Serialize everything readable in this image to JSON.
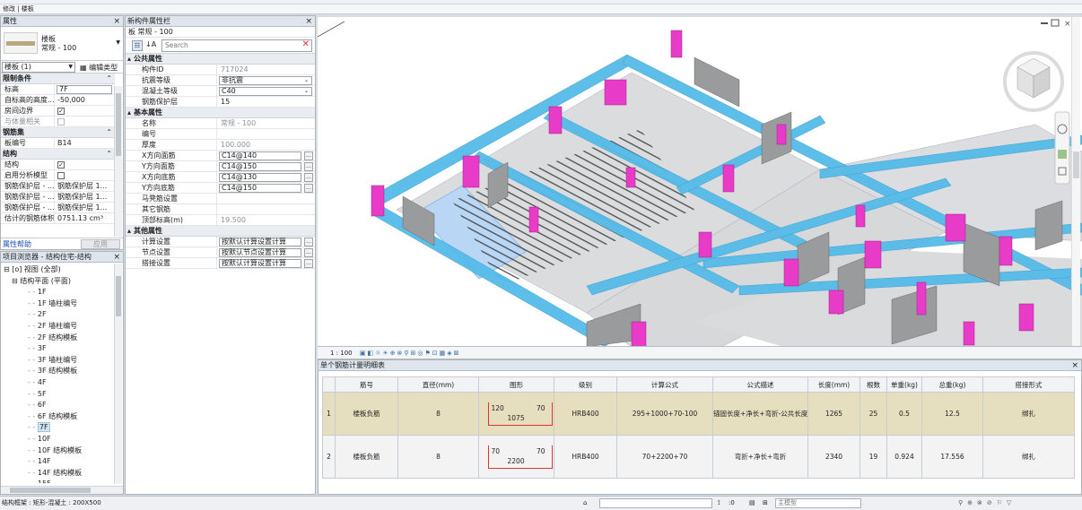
{
  "modebar": {
    "text": "修改 | 楼板"
  },
  "left_panel": {
    "title": "属性",
    "type_name": "楼板",
    "type_sub": "常规 - 100",
    "instance_selector": "楼板 (1)",
    "edit_type": "编辑类型",
    "groups": [
      {
        "name": "限制条件",
        "rows": [
          {
            "label": "标高",
            "value": "7F",
            "kind": "input"
          },
          {
            "label": "自标高的高度...",
            "value": "-50,000",
            "kind": "text"
          },
          {
            "label": "房间边界",
            "value": "✓",
            "kind": "check"
          },
          {
            "label": "与体量相关",
            "value": "",
            "kind": "check-gray"
          }
        ]
      },
      {
        "name": "钢筋集",
        "rows": [
          {
            "label": "板编号",
            "value": "B14",
            "kind": "text"
          }
        ]
      },
      {
        "name": "结构",
        "rows": [
          {
            "label": "结构",
            "value": "✓",
            "kind": "check"
          },
          {
            "label": "启用分析模型",
            "value": "",
            "kind": "check"
          },
          {
            "label": "钢筋保护层 - ...",
            "value": "钢筋保护层 1...",
            "kind": "text"
          },
          {
            "label": "钢筋保护层 - ...",
            "value": "钢筋保护层 1...",
            "kind": "text"
          },
          {
            "label": "钢筋保护层 - ...",
            "value": "钢筋保护层 1...",
            "kind": "text"
          },
          {
            "label": "估计的钢筋体积",
            "value": "0751.13 cm³",
            "kind": "text"
          }
        ]
      }
    ],
    "help_link": "属性帮助",
    "apply": "应用"
  },
  "browser": {
    "title": "项目浏览器 - 结构住宅-结构",
    "items": [
      {
        "text": "⊟ [o] 视图 (全部)",
        "indent": 0
      },
      {
        "text": "⊟ 结构平面 (平面)",
        "indent": 1
      },
      {
        "text": "1F",
        "indent": 2
      },
      {
        "text": "1F 墙柱编号",
        "indent": 2
      },
      {
        "text": "2F",
        "indent": 2
      },
      {
        "text": "2F 墙柱编号",
        "indent": 2
      },
      {
        "text": "2F 结构模板",
        "indent": 2
      },
      {
        "text": "3F",
        "indent": 2
      },
      {
        "text": "3F 墙柱编号",
        "indent": 2
      },
      {
        "text": "3F 结构模板",
        "indent": 2
      },
      {
        "text": "4F",
        "indent": 2
      },
      {
        "text": "5F",
        "indent": 2
      },
      {
        "text": "6F",
        "indent": 2
      },
      {
        "text": "6F 结构模板",
        "indent": 2
      },
      {
        "text": "7F",
        "indent": 2,
        "selected": true
      },
      {
        "text": "10F",
        "indent": 2
      },
      {
        "text": "10F 结构模板",
        "indent": 2
      },
      {
        "text": "14F",
        "indent": 2
      },
      {
        "text": "14F 结构模板",
        "indent": 2
      },
      {
        "text": "15F",
        "indent": 2
      }
    ]
  },
  "mid_panel": {
    "title": "新构件属性栏",
    "type": "板 常规 - 100",
    "search_placeholder": "Search",
    "sections": [
      {
        "name": "公共属性",
        "rows": [
          {
            "label": "构件ID",
            "value": "717024",
            "kind": "gray"
          },
          {
            "label": "抗震等级",
            "value": "非抗震",
            "kind": "select"
          },
          {
            "label": "混凝土等级",
            "value": "C40",
            "kind": "select"
          },
          {
            "label": "钢筋保护层",
            "value": "15",
            "kind": "text"
          }
        ]
      },
      {
        "name": "基本属性",
        "rows": [
          {
            "label": "名称",
            "value": "常规 - 100",
            "kind": "gray"
          },
          {
            "label": "编号",
            "value": "",
            "kind": "text"
          },
          {
            "label": "厚度",
            "value": "100.000",
            "kind": "gray"
          },
          {
            "label": "X方向面筋",
            "value": "C14@140",
            "kind": "ellipsis"
          },
          {
            "label": "Y方向面筋",
            "value": "C14@150",
            "kind": "ellipsis"
          },
          {
            "label": "X方向底筋",
            "value": "C14@130",
            "kind": "ellipsis"
          },
          {
            "label": "Y方向底筋",
            "value": "C14@150",
            "kind": "ellipsis"
          },
          {
            "label": "马凳筋设置",
            "value": "",
            "kind": "text"
          },
          {
            "label": "其它钢筋",
            "value": "",
            "kind": "text"
          },
          {
            "label": "顶部标高(m)",
            "value": "19.500",
            "kind": "gray"
          }
        ]
      },
      {
        "name": "其他属性",
        "rows": [
          {
            "label": "计算设置",
            "value": "按默认计算设置计算",
            "kind": "ellipsis"
          },
          {
            "label": "节点设置",
            "value": "按默认节点设置计算",
            "kind": "ellipsis"
          },
          {
            "label": "搭接设置",
            "value": "按默认计算设置计算",
            "kind": "ellipsis"
          }
        ]
      }
    ]
  },
  "viewbar": {
    "scale": "1 : 100"
  },
  "rebar_table": {
    "title": "单个钢筋计量明细表",
    "headers": [
      "",
      "筋号",
      "直径(mm)",
      "图形",
      "级别",
      "计算公式",
      "公式描述",
      "长度(mm)",
      "根数",
      "单重(kg)",
      "总重(kg)",
      "搭接形式"
    ],
    "rows": [
      {
        "no": "1",
        "name": "楼板负筋",
        "dia": "8",
        "shape_left": "120",
        "shape_mid": "1075",
        "shape_right": "70",
        "grade": "HRB400",
        "formula": "295+1000+70-100",
        "desc": "锚固长度+净长+弯折-公共长度",
        "length": "1265",
        "count": "25",
        "unit": "0.5",
        "total": "12.5",
        "lap": "绑扎"
      },
      {
        "no": "2",
        "name": "楼板负筋",
        "dia": "8",
        "shape_left": "70",
        "shape_mid": "2200",
        "shape_right": "70",
        "grade": "HRB400",
        "formula": "70+2200+70",
        "desc": "弯折+净长+弯折",
        "length": "2340",
        "count": "19",
        "unit": "0.924",
        "total": "17.556",
        "lap": "绑扎"
      }
    ]
  },
  "status": {
    "text": "结构框架 : 矩形-混凝土 : 200X500",
    "zero": ":0",
    "model": "主模型"
  },
  "colors": {
    "accent": "#e83cc8",
    "beam": "#4fb6e6",
    "slab": "#d9dadb",
    "highlight": "#b9d6f5"
  }
}
